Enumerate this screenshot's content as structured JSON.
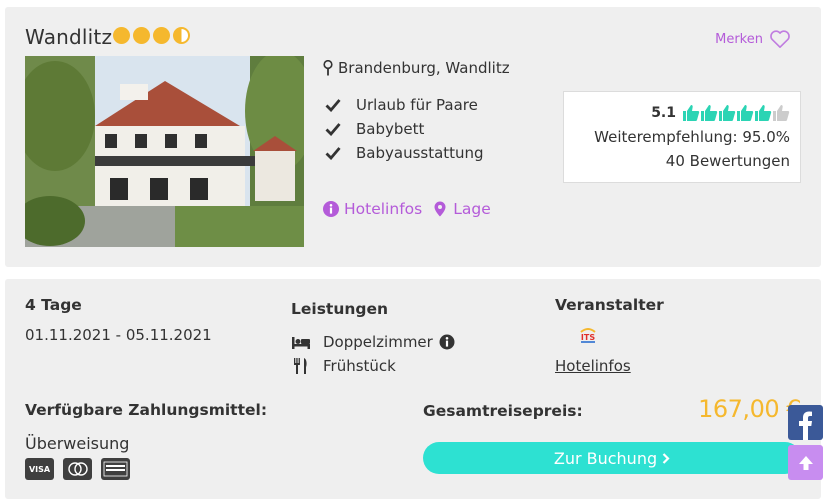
{
  "hotel": {
    "name": "Wandlitz",
    "stars": 3.5,
    "location": "Brandenburg, Wandlitz",
    "features": [
      "Urlaub für Paare",
      "Babybett",
      "Babyausstattung"
    ],
    "links": {
      "hotelinfos": "Hotelinfos",
      "lage": "Lage"
    },
    "merken_label": "Merken"
  },
  "rating": {
    "score": "5.1",
    "thumbs": 6,
    "recommendation": "Weiterempfehlung: 95.0%",
    "reviews": "40 Bewertungen"
  },
  "offer": {
    "duration": "4 Tage",
    "dates": "01.11.2021 - 05.11.2021",
    "leistungen_title": "Leistungen",
    "room": "Doppelzimmer",
    "board": "Frühstück",
    "veranstalter_title": "Veranstalter",
    "veranstalter_logo": "ITS",
    "veranstalter_link": "Hotelinfos"
  },
  "payment": {
    "title": "Verfügbare Zahlungsmittel:",
    "method": "Überweisung",
    "cards": [
      "VISA",
      "MC",
      "AMEX"
    ]
  },
  "price": {
    "label": "Gesamtreisepreis:",
    "value": "167,00 €"
  },
  "buttons": {
    "book": "Zur Buchung"
  },
  "colors": {
    "accent": "#b45bd9",
    "star": "#f5b82e",
    "cta": "#2de1d2",
    "thumb": "#2bd4b4",
    "price": "#f5b82e"
  },
  "icons": {
    "facebook": "facebook-icon",
    "scroll_up": "arrow-up-icon"
  }
}
